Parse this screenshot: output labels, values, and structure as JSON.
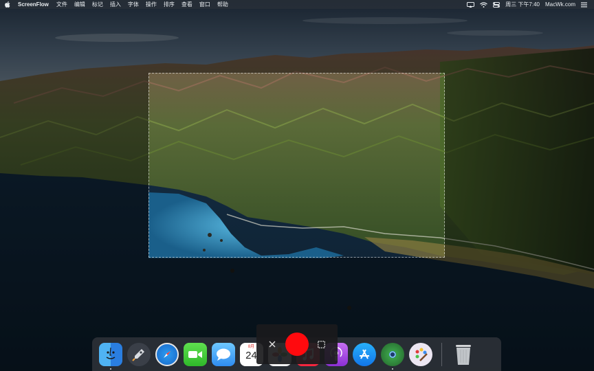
{
  "menubar": {
    "app_name": "ScreenFlow",
    "menus": [
      "文件",
      "编辑",
      "标记",
      "插入",
      "字体",
      "操作",
      "排序",
      "查看",
      "窗口",
      "帮助"
    ],
    "clock": "周三 下午7:40",
    "site": "MacWk.com"
  },
  "dock": {
    "apps": [
      {
        "icon": "finder-icon"
      },
      {
        "icon": "launchpad-icon"
      },
      {
        "icon": "safari-icon"
      },
      {
        "icon": "facetime-icon"
      },
      {
        "icon": "messages-icon"
      },
      {
        "icon": "calendar-icon",
        "month": "8月",
        "day": "24"
      },
      {
        "icon": "photos-icon"
      },
      {
        "icon": "music-icon"
      },
      {
        "icon": "podcasts-icon"
      },
      {
        "icon": "app-store-icon"
      },
      {
        "icon": "screenflow-icon"
      },
      {
        "icon": "paintbrush-icon"
      },
      {
        "icon": "trash-icon"
      }
    ]
  },
  "recorder": {
    "record_color": "#ff0a0e"
  }
}
